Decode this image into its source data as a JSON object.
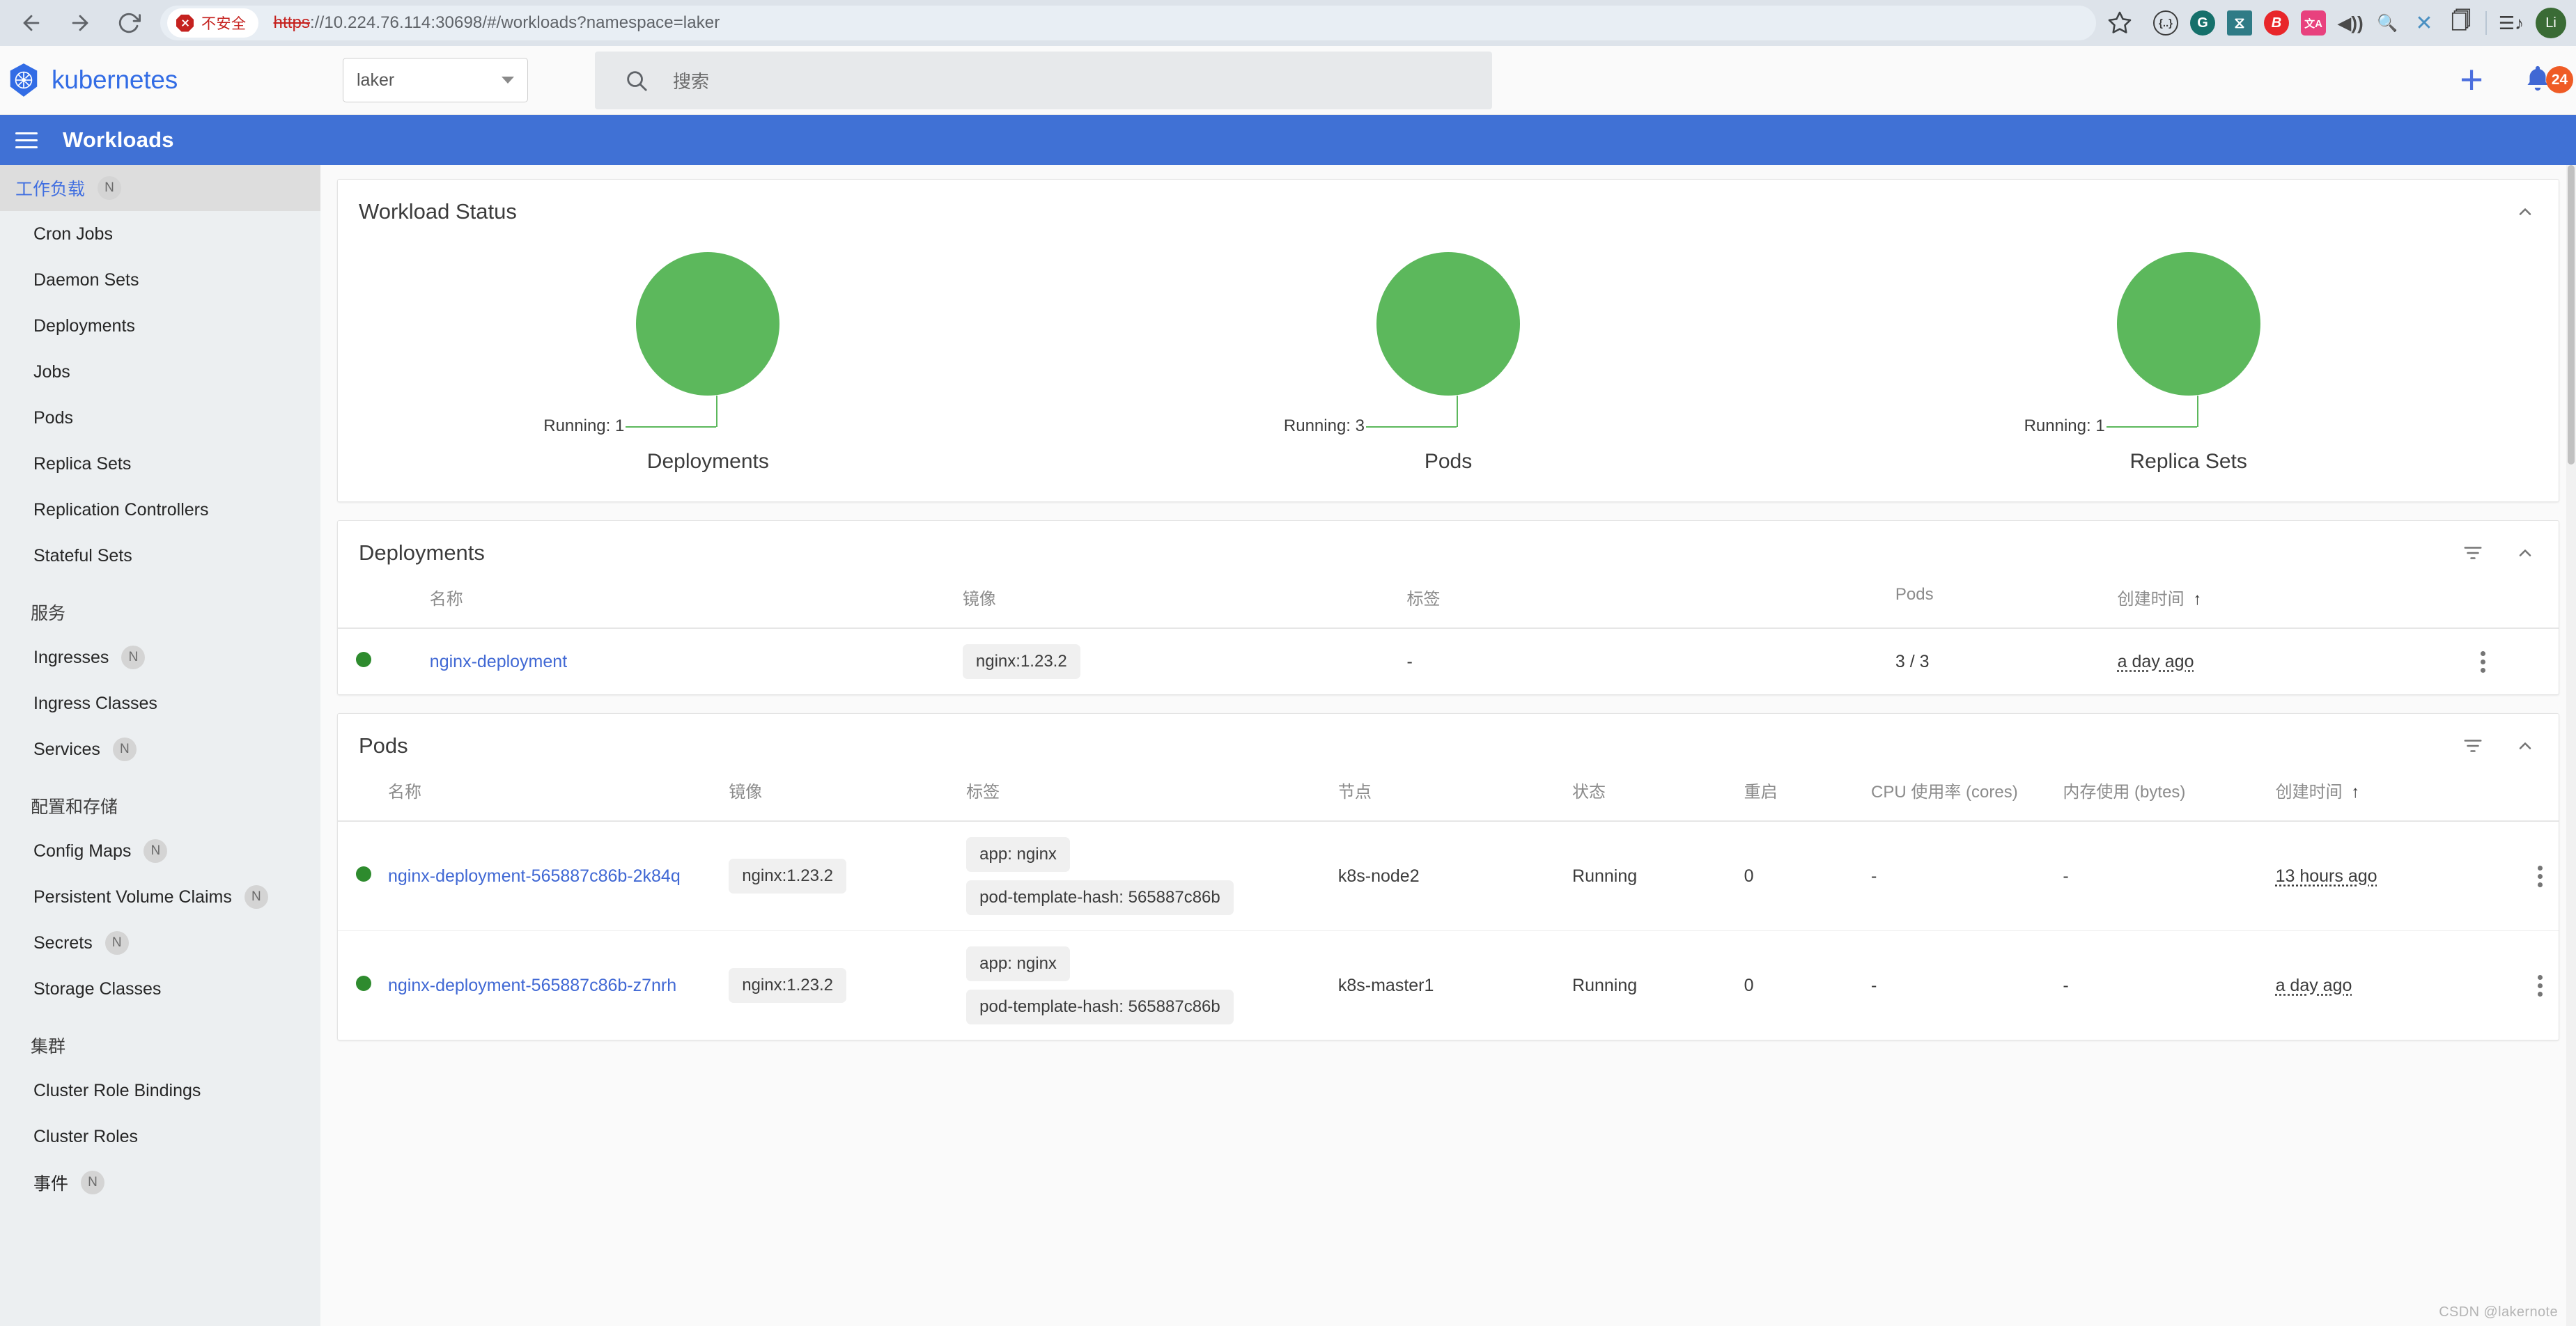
{
  "browser": {
    "back_icon": "back-arrow-icon",
    "forward_icon": "forward-arrow-icon",
    "reload_icon": "reload-icon",
    "security_label": "不安全",
    "url_scheme": "https",
    "url_rest": "://10.224.76.114:30698/#/workloads?namespace=laker",
    "url_full": "https://10.224.76.114:30698/#/workloads?namespace=laker",
    "bookmark_icon": "star-icon",
    "extensions": [
      {
        "name": "json-viewer-extension",
        "glyph": "{..}",
        "bg": "#ffffff",
        "fg": "#3c3c3c"
      },
      {
        "name": "grammarly-extension",
        "glyph": "G",
        "bg": "#15706b",
        "fg": "#ffffff"
      },
      {
        "name": "wayback-extension",
        "glyph": "W",
        "bg": "#2f7b86",
        "fg": "#ffffff"
      },
      {
        "name": "bitwarden-extension",
        "glyph": "B",
        "bg": "#e8262a",
        "fg": "#ffffff"
      },
      {
        "name": "translate-extension",
        "glyph": "文A",
        "bg": "#e8417e",
        "fg": "#ffffff"
      },
      {
        "name": "volume-extension",
        "glyph": "🔊",
        "bg": "transparent",
        "fg": "#4a4a4a"
      },
      {
        "name": "magnifier-extension",
        "glyph": "🔍",
        "bg": "transparent",
        "fg": "#4a6fa5"
      },
      {
        "name": "xmind-extension",
        "glyph": "✕",
        "bg": "transparent",
        "fg": "#4a90c2"
      },
      {
        "name": "clipboard-extension",
        "glyph": "🗍",
        "bg": "transparent",
        "fg": "#3c3c3c"
      }
    ],
    "menu_icon": "list-menu-icon",
    "profile_initial": "Li"
  },
  "header": {
    "logo_text": "kubernetes",
    "logo_icon": "kubernetes-wheel-icon",
    "namespace_value": "laker",
    "namespace_caret": "chevron-down-icon",
    "search_icon": "search-icon",
    "search_placeholder": "搜索",
    "search_value": "",
    "create_icon": "plus-icon",
    "notification_icon": "bell-icon",
    "notification_count": "24",
    "accent_color": "#326ce5"
  },
  "toolbar": {
    "menu_icon": "hamburger-menu-icon",
    "page_title": "Workloads",
    "bar_color": "#4071d5"
  },
  "sidebar": {
    "groups": [
      {
        "heading": null,
        "items": [
          {
            "label": "工作负载",
            "badge": "N",
            "active": true
          }
        ]
      },
      {
        "heading": null,
        "items": [
          {
            "label": "Cron Jobs",
            "badge": null,
            "active": false
          },
          {
            "label": "Daemon Sets",
            "badge": null,
            "active": false
          },
          {
            "label": "Deployments",
            "badge": null,
            "active": false
          },
          {
            "label": "Jobs",
            "badge": null,
            "active": false
          },
          {
            "label": "Pods",
            "badge": null,
            "active": false
          },
          {
            "label": "Replica Sets",
            "badge": null,
            "active": false
          },
          {
            "label": "Replication Controllers",
            "badge": null,
            "active": false
          },
          {
            "label": "Stateful Sets",
            "badge": null,
            "active": false
          }
        ]
      },
      {
        "heading": "服务",
        "items": [
          {
            "label": "Ingresses",
            "badge": "N",
            "active": false
          },
          {
            "label": "Ingress Classes",
            "badge": null,
            "active": false
          },
          {
            "label": "Services",
            "badge": "N",
            "active": false
          }
        ]
      },
      {
        "heading": "配置和存储",
        "items": [
          {
            "label": "Config Maps",
            "badge": "N",
            "active": false
          },
          {
            "label": "Persistent Volume Claims",
            "badge": "N",
            "active": false
          },
          {
            "label": "Secrets",
            "badge": "N",
            "active": false
          },
          {
            "label": "Storage Classes",
            "badge": null,
            "active": false
          }
        ]
      },
      {
        "heading": "集群",
        "items": [
          {
            "label": "Cluster Role Bindings",
            "badge": null,
            "active": false
          },
          {
            "label": "Cluster Roles",
            "badge": null,
            "active": false
          },
          {
            "label": "事件",
            "badge": "N",
            "active": false
          }
        ]
      }
    ]
  },
  "workload_status": {
    "title": "Workload Status",
    "collapse_icon": "chevron-up-icon"
  },
  "chart_data": [
    {
      "type": "pie",
      "title": "Deployments",
      "categories": [
        "Running"
      ],
      "values": [
        1
      ],
      "labels": [
        "Running: 1"
      ],
      "colors": [
        "#5cb85c"
      ],
      "legend": "callout"
    },
    {
      "type": "pie",
      "title": "Pods",
      "categories": [
        "Running"
      ],
      "values": [
        3
      ],
      "labels": [
        "Running: 3"
      ],
      "colors": [
        "#5cb85c"
      ],
      "legend": "callout"
    },
    {
      "type": "pie",
      "title": "Replica Sets",
      "categories": [
        "Running"
      ],
      "values": [
        1
      ],
      "labels": [
        "Running: 1"
      ],
      "colors": [
        "#5cb85c"
      ],
      "legend": "callout"
    }
  ],
  "deployments": {
    "title": "Deployments",
    "filter_icon": "filter-icon",
    "collapse_icon": "chevron-up-icon",
    "columns": [
      "名称",
      "镜像",
      "标签",
      "Pods",
      "创建时间"
    ],
    "sort_column": "创建时间",
    "sort_arrow": "↑",
    "rows": [
      {
        "status": "running",
        "name": "nginx-deployment",
        "image": "nginx:1.23.2",
        "labels": "-",
        "pods": "3 / 3",
        "age": "a day ago",
        "menu_icon": "kebab-menu-icon"
      }
    ]
  },
  "pods": {
    "title": "Pods",
    "filter_icon": "filter-icon",
    "collapse_icon": "chevron-up-icon",
    "columns": [
      "名称",
      "镜像",
      "标签",
      "节点",
      "状态",
      "重启",
      "CPU 使用率 (cores)",
      "内存使用 (bytes)",
      "创建时间"
    ],
    "sort_column": "创建时间",
    "sort_arrow": "↑",
    "rows": [
      {
        "status": "running",
        "name": "nginx-deployment-565887c86b-2k84q",
        "image": "nginx:1.23.2",
        "labels": [
          "app: nginx",
          "pod-template-hash: 565887c86b"
        ],
        "node": "k8s-node2",
        "state": "Running",
        "restarts": "0",
        "cpu": "-",
        "memory": "-",
        "age": "13 hours ago",
        "menu_icon": "kebab-menu-icon"
      },
      {
        "status": "running",
        "name": "nginx-deployment-565887c86b-z7nrh",
        "image": "nginx:1.23.2",
        "labels": [
          "app: nginx",
          "pod-template-hash: 565887c86b"
        ],
        "node": "k8s-master1",
        "state": "Running",
        "restarts": "0",
        "cpu": "-",
        "memory": "-",
        "age": "a day ago",
        "menu_icon": "kebab-menu-icon"
      }
    ]
  },
  "watermark": "CSDN @lakernote"
}
